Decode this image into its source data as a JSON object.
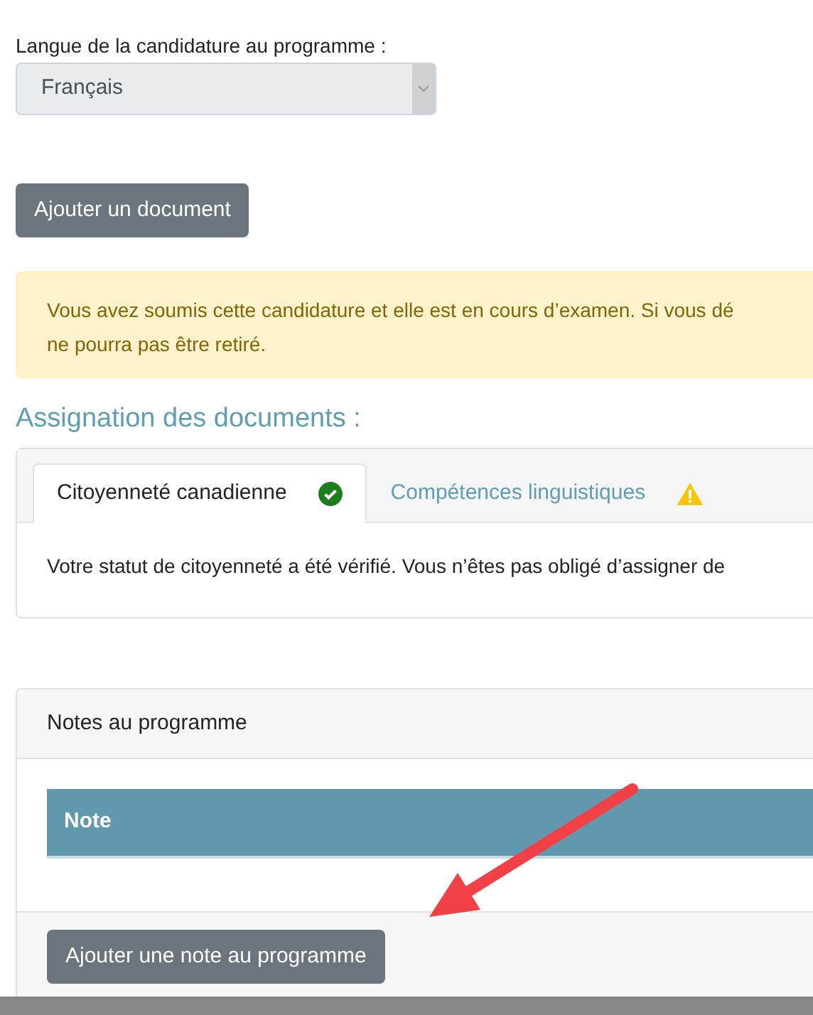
{
  "language_field": {
    "label": "Langue de la candidature au programme :",
    "value": "Français",
    "disabled": true
  },
  "add_document_button": "Ajouter un document",
  "alert": {
    "lines": [
      "Vous avez soumis cette candidature et elle est en cours d’examen. Si vous dé",
      "ne pourra pas être retiré."
    ]
  },
  "documents": {
    "heading": "Assignation des documents :",
    "tabs": [
      {
        "label": "Citoyenneté canadienne",
        "selected": true,
        "kind": "verified"
      },
      {
        "label": "Compétences linguistiques",
        "selected": false,
        "kind": "warning"
      }
    ],
    "panel_text": "Votre statut de citoyenneté a été vérifié. Vous n’êtes pas obligé d’assigner de"
  },
  "notes": {
    "title": "Notes au programme",
    "columns": [
      "Note"
    ],
    "add_button": "Ajouter une note au programme"
  }
}
